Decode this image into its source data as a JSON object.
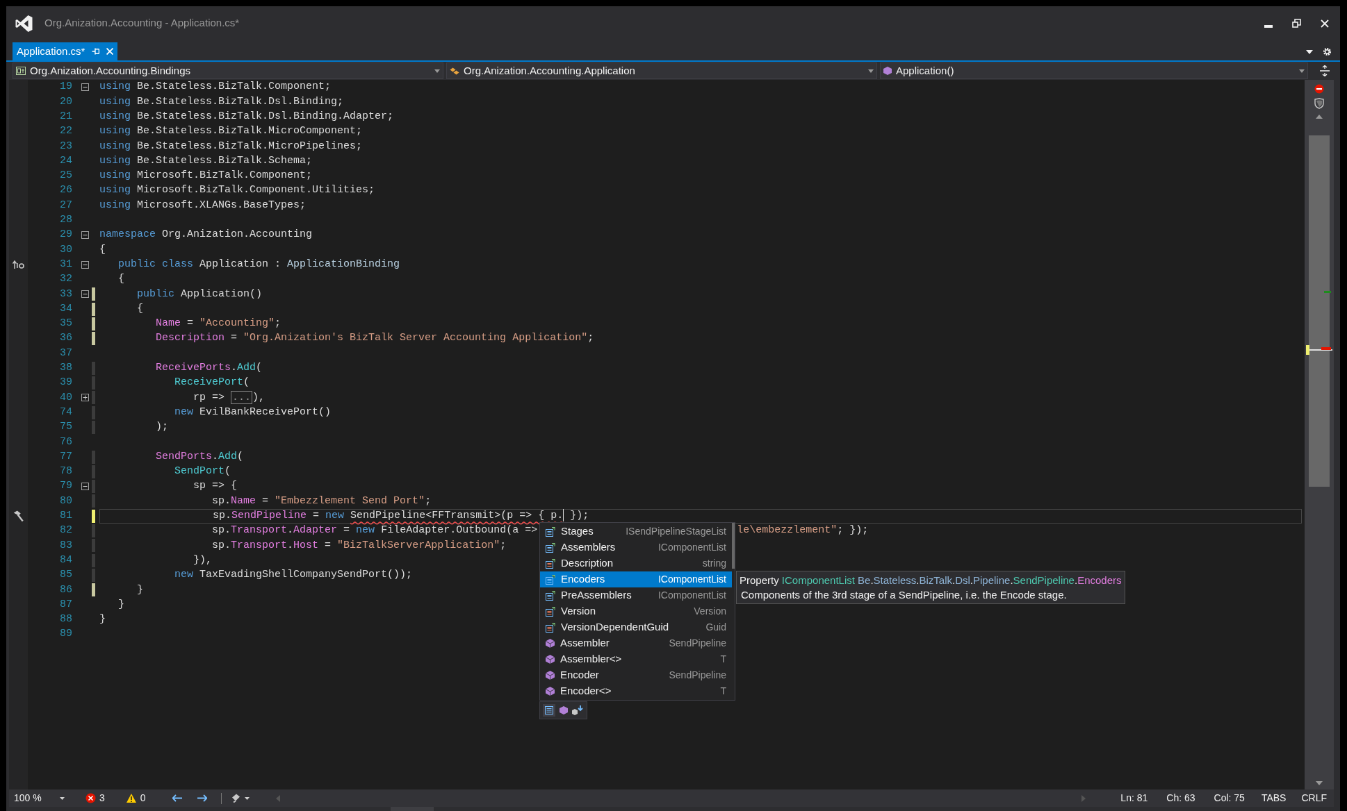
{
  "window": {
    "title": "Org.Anization.Accounting - Application.cs*"
  },
  "tabs": [
    {
      "label": "Application.cs*",
      "selected": true
    }
  ],
  "navigation": [
    {
      "kind": "project",
      "label": "Org.Anization.Accounting.Bindings"
    },
    {
      "kind": "class",
      "label": "Org.Anization.Accounting.Application"
    },
    {
      "kind": "member",
      "label": "Application()"
    }
  ],
  "editor": {
    "lines": [
      {
        "number": "19",
        "folded": false,
        "tokens": [
          {
            "text": "using ",
            "kind": "kw"
          },
          {
            "text": "Be.Stateless.BizTalk.Component;",
            "kind": "plain"
          }
        ]
      },
      {
        "number": "20",
        "tokens": [
          {
            "text": "using ",
            "kind": "kw"
          },
          {
            "text": "Be.Stateless.BizTalk.Dsl.Binding;",
            "kind": "plain"
          }
        ]
      },
      {
        "number": "21",
        "tokens": [
          {
            "text": "using ",
            "kind": "kw"
          },
          {
            "text": "Be.Stateless.BizTalk.Dsl.Binding.Adapter;",
            "kind": "plain"
          }
        ]
      },
      {
        "number": "22",
        "tokens": [
          {
            "text": "using ",
            "kind": "kw"
          },
          {
            "text": "Be.Stateless.BizTalk.MicroComponent;",
            "kind": "plain"
          }
        ]
      },
      {
        "number": "23",
        "tokens": [
          {
            "text": "using ",
            "kind": "kw"
          },
          {
            "text": "Be.Stateless.BizTalk.MicroPipelines;",
            "kind": "plain"
          }
        ]
      },
      {
        "number": "24",
        "tokens": [
          {
            "text": "using ",
            "kind": "kw"
          },
          {
            "text": "Be.Stateless.BizTalk.Schema;",
            "kind": "plain"
          }
        ]
      },
      {
        "number": "25",
        "tokens": [
          {
            "text": "using ",
            "kind": "kw"
          },
          {
            "text": "Microsoft.BizTalk.Component;",
            "kind": "plain"
          }
        ]
      },
      {
        "number": "26",
        "tokens": [
          {
            "text": "using ",
            "kind": "kw"
          },
          {
            "text": "Microsoft.BizTalk.Component.Utilities;",
            "kind": "plain"
          }
        ]
      },
      {
        "number": "27",
        "tokens": [
          {
            "text": "using ",
            "kind": "kw"
          },
          {
            "text": "Microsoft.XLANGs.BaseTypes;",
            "kind": "plain"
          }
        ]
      },
      {
        "number": "28"
      },
      {
        "number": "29",
        "folded": false,
        "tokens": [
          {
            "text": "namespace ",
            "kind": "kw"
          },
          {
            "text": "Org.Anization.Accounting",
            "kind": "plain"
          }
        ]
      },
      {
        "number": "30",
        "tokens": [
          {
            "text": "{",
            "kind": "plain"
          }
        ]
      },
      {
        "number": "31",
        "folded": false,
        "glyph": {
          "kind": "implements"
        },
        "tokens": [
          {
            "text": "   public class ",
            "kind": "kw"
          },
          {
            "text": "Application",
            "kind": "plain"
          },
          {
            "text": " : ",
            "kind": "plain"
          },
          {
            "text": "ApplicationBinding",
            "kind": "type"
          }
        ]
      },
      {
        "number": "32",
        "tokens": [
          {
            "text": "   {",
            "kind": "plain"
          }
        ]
      },
      {
        "number": "33",
        "folded": false,
        "color": "#c8c8a0",
        "tokens": [
          {
            "text": "      public ",
            "kind": "kw"
          },
          {
            "text": "Application()",
            "kind": "plain"
          }
        ]
      },
      {
        "number": "34",
        "color": "#c8c8a0",
        "tokens": [
          {
            "text": "      {",
            "kind": "plain"
          }
        ]
      },
      {
        "number": "35",
        "color": "#c8c8a0",
        "tokens": [
          {
            "text": "         Name",
            "kind": "prop"
          },
          {
            "text": " = ",
            "kind": "plain"
          },
          {
            "text": "\"Accounting\"",
            "kind": "str"
          },
          {
            "text": ";",
            "kind": "plain"
          }
        ]
      },
      {
        "number": "36",
        "color": "#c8c8a0",
        "tokens": [
          {
            "text": "         Description",
            "kind": "prop"
          },
          {
            "text": " = ",
            "kind": "plain"
          },
          {
            "text": "\"Org.Anization's BizTalk Server Accounting Application\"",
            "kind": "str"
          },
          {
            "text": ";",
            "kind": "plain"
          }
        ]
      },
      {
        "number": "37"
      },
      {
        "number": "38",
        "color": "#3c3c3c",
        "tokens": [
          {
            "text": "         ReceivePorts",
            "kind": "prop"
          },
          {
            "text": ".",
            "kind": "plain"
          },
          {
            "text": "Add",
            "kind": "method"
          },
          {
            "text": "(",
            "kind": "plain"
          }
        ]
      },
      {
        "number": "39",
        "color": "#3c3c3c",
        "tokens": [
          {
            "text": "            ReceivePort",
            "kind": "method"
          },
          {
            "text": "(",
            "kind": "plain"
          }
        ]
      },
      {
        "number": "40",
        "folded": true,
        "color": "#3c3c3c",
        "tokens": [
          {
            "text": "               rp => ",
            "kind": "plain"
          },
          {
            "text": "...",
            "kind": "collapsed"
          },
          {
            "text": "),",
            "kind": "plain"
          }
        ]
      },
      {
        "number": "74",
        "color": "#3c3c3c",
        "tokens": [
          {
            "text": "            new ",
            "kind": "kw"
          },
          {
            "text": "EvilBankReceivePort()",
            "kind": "plain"
          }
        ]
      },
      {
        "number": "75",
        "color": "#3c3c3c",
        "tokens": [
          {
            "text": "         );",
            "kind": "plain"
          }
        ]
      },
      {
        "number": "76"
      },
      {
        "number": "77",
        "color": "#3c3c3c",
        "tokens": [
          {
            "text": "         SendPorts",
            "kind": "prop"
          },
          {
            "text": ".",
            "kind": "plain"
          },
          {
            "text": "Add",
            "kind": "method"
          },
          {
            "text": "(",
            "kind": "plain"
          }
        ]
      },
      {
        "number": "78",
        "color": "#3c3c3c",
        "tokens": [
          {
            "text": "            SendPort",
            "kind": "method"
          },
          {
            "text": "(",
            "kind": "plain"
          }
        ]
      },
      {
        "number": "79",
        "folded": false,
        "color": "#3c3c3c",
        "tokens": [
          {
            "text": "               sp => {",
            "kind": "plain"
          }
        ]
      },
      {
        "number": "80",
        "color": "#3c3c3c",
        "tokens": [
          {
            "text": "                  sp.",
            "kind": "plain"
          },
          {
            "text": "Name",
            "kind": "prop"
          },
          {
            "text": " = ",
            "kind": "plain"
          },
          {
            "text": "\"Embezzlement Send Port\"",
            "kind": "str"
          },
          {
            "text": ";",
            "kind": "plain"
          }
        ]
      },
      {
        "number": "81",
        "current": true,
        "glyph": {
          "kind": "hammer"
        },
        "color": "#efef70",
        "tokens": [
          {
            "text": "                  sp.",
            "kind": "plain"
          },
          {
            "text": "SendPipeline",
            "kind": "prop"
          },
          {
            "text": " = ",
            "kind": "plain"
          },
          {
            "text": "new ",
            "kind": "kw"
          },
          {
            "text": "SendPipeline<FFTransmit>(p => { p.",
            "kind": "plain",
            "error": true,
            "caret": true
          },
          {
            "text": " });",
            "kind": "plain"
          }
        ]
      },
      {
        "number": "82",
        "color": "#3c3c3c",
        "tokens": [
          {
            "text": "                  sp.",
            "kind": "plain"
          },
          {
            "text": "Transport",
            "kind": "prop"
          },
          {
            "text": ".",
            "kind": "plain"
          },
          {
            "text": "Adapter",
            "kind": "prop"
          },
          {
            "text": " = ",
            "kind": "plain"
          },
          {
            "text": "new ",
            "kind": "kw"
          },
          {
            "text": "FileAdapter.Outbound(a =>",
            "kind": "plain"
          }
        ],
        "after_popup": [
          {
            "text": "le\\embezzlement\"",
            "kind": "str"
          },
          {
            "text": "; });",
            "kind": "plain"
          }
        ]
      },
      {
        "number": "83",
        "color": "#3c3c3c",
        "tokens": [
          {
            "text": "                  sp.",
            "kind": "plain"
          },
          {
            "text": "Transport",
            "kind": "prop"
          },
          {
            "text": ".",
            "kind": "plain"
          },
          {
            "text": "Host",
            "kind": "prop"
          },
          {
            "text": " = ",
            "kind": "plain"
          },
          {
            "text": "\"BizTalkServerApplication\"",
            "kind": "str"
          },
          {
            "text": ";",
            "kind": "plain"
          }
        ]
      },
      {
        "number": "84",
        "color": "#3c3c3c",
        "tokens": [
          {
            "text": "               }),",
            "kind": "plain"
          }
        ]
      },
      {
        "number": "85",
        "color": "#3c3c3c",
        "tokens": [
          {
            "text": "            new ",
            "kind": "kw"
          },
          {
            "text": "TaxEvadingShellCompanySendPort());",
            "kind": "plain"
          }
        ]
      },
      {
        "number": "86",
        "color": "#c8c8a0",
        "tokens": [
          {
            "text": "      }",
            "kind": "plain"
          }
        ]
      },
      {
        "number": "87",
        "tokens": [
          {
            "text": "   }",
            "kind": "plain"
          }
        ]
      },
      {
        "number": "88",
        "tokens": [
          {
            "text": "}",
            "kind": "plain"
          }
        ]
      },
      {
        "number": "89"
      }
    ]
  },
  "completion": {
    "items": [
      {
        "label": "Stages",
        "type": "ISendPipelineStageList",
        "kind": "property",
        "selected": false
      },
      {
        "label": "Assemblers",
        "type": "IComponentList",
        "kind": "property",
        "selected": false
      },
      {
        "label": "Description",
        "type": "string",
        "kind": "extension",
        "selected": false
      },
      {
        "label": "Encoders",
        "type": "IComponentList",
        "kind": "property",
        "selected": true
      },
      {
        "label": "PreAssemblers",
        "type": "IComponentList",
        "kind": "property",
        "selected": false
      },
      {
        "label": "Version",
        "type": "Version",
        "kind": "extension",
        "selected": false
      },
      {
        "label": "VersionDependentGuid",
        "type": "Guid",
        "kind": "extension",
        "selected": false
      },
      {
        "label": "Assembler",
        "type": "SendPipeline",
        "kind": "method",
        "selected": false
      },
      {
        "label": "Assembler<>",
        "type": "T",
        "kind": "method",
        "selected": false
      },
      {
        "label": "Encoder",
        "type": "SendPipeline",
        "kind": "method",
        "selected": false
      },
      {
        "label": "Encoder<>",
        "type": "T",
        "kind": "method",
        "selected": false
      }
    ],
    "tooltip": {
      "signature": [
        {
          "text": "Property ",
          "kind": "plain"
        },
        {
          "text": "IComponentList",
          "kind": "type"
        },
        {
          "text": " Be",
          "kind": "ns"
        },
        {
          "text": ".",
          "kind": "plain"
        },
        {
          "text": "Stateless",
          "kind": "ns"
        },
        {
          "text": ".",
          "kind": "plain"
        },
        {
          "text": "BizTalk",
          "kind": "ns"
        },
        {
          "text": ".",
          "kind": "plain"
        },
        {
          "text": "Dsl",
          "kind": "ns"
        },
        {
          "text": ".",
          "kind": "plain"
        },
        {
          "text": "Pipeline",
          "kind": "ns"
        },
        {
          "text": ".",
          "kind": "plain"
        },
        {
          "text": "SendPipeline",
          "kind": "type"
        },
        {
          "text": ".",
          "kind": "plain"
        },
        {
          "text": "Encoders",
          "kind": "member"
        }
      ],
      "description": "Components of the 3rd stage of a SendPipeline, i.e. the Encode stage."
    }
  },
  "status_bar": {
    "zoom": "100 %",
    "errors": "3",
    "warnings": "0",
    "line": "Ln: 81",
    "char": "Ch: 63",
    "col": "Col: 75",
    "indent": "TABS",
    "line_ending": "CRLF"
  }
}
